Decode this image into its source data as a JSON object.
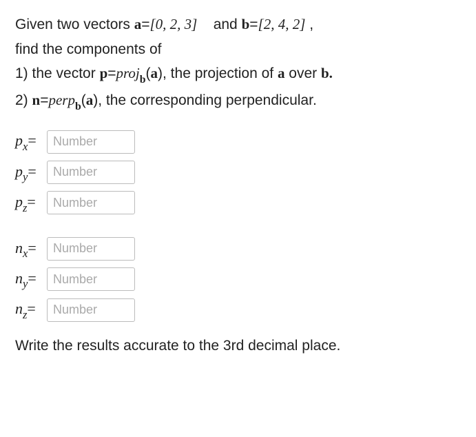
{
  "problem": {
    "line1_pre": "Given two vectors ",
    "a_label": "a",
    "eq1": "=",
    "a_vec": "[0, 2, 3]",
    "and": "    and ",
    "b_label": "b",
    "eq2": "=",
    "b_vec": "[2, 4, 2]",
    "line1_post": " ,",
    "line2": "find the components of",
    "item1_pre": "1) the vector ",
    "p_label": "p",
    "eq3": "=",
    "proj_label": "proj",
    "proj_sub": "b",
    "proj_arg_open": "(",
    "proj_arg": "a",
    "proj_arg_close": ")",
    "item1_post": ", the projection of ",
    "item1_a": "a",
    "item1_over": " over ",
    "item1_b": "b.",
    "item2_pre": "2) ",
    "n_label": "n",
    "eq4": "=",
    "perp_label": "perp",
    "perp_sub": "b",
    "perp_arg_open": "(",
    "perp_arg": "a",
    "perp_arg_close": ")",
    "item2_post": ", the corresponding perpendicular."
  },
  "inputs": {
    "px": {
      "label_var": "p",
      "label_sub": "x",
      "label_eq": "=",
      "placeholder": "Number"
    },
    "py": {
      "label_var": "p",
      "label_sub": "y",
      "label_eq": "=",
      "placeholder": "Number"
    },
    "pz": {
      "label_var": "p",
      "label_sub": "z",
      "label_eq": "=",
      "placeholder": "Number"
    },
    "nx": {
      "label_var": "n",
      "label_sub": "x",
      "label_eq": "=",
      "placeholder": "Number"
    },
    "ny": {
      "label_var": "n",
      "label_sub": "y",
      "label_eq": "=",
      "placeholder": "Number"
    },
    "nz": {
      "label_var": "n",
      "label_sub": "z",
      "label_eq": "=",
      "placeholder": "Number"
    }
  },
  "footer": "Write the results accurate to the 3rd decimal place."
}
